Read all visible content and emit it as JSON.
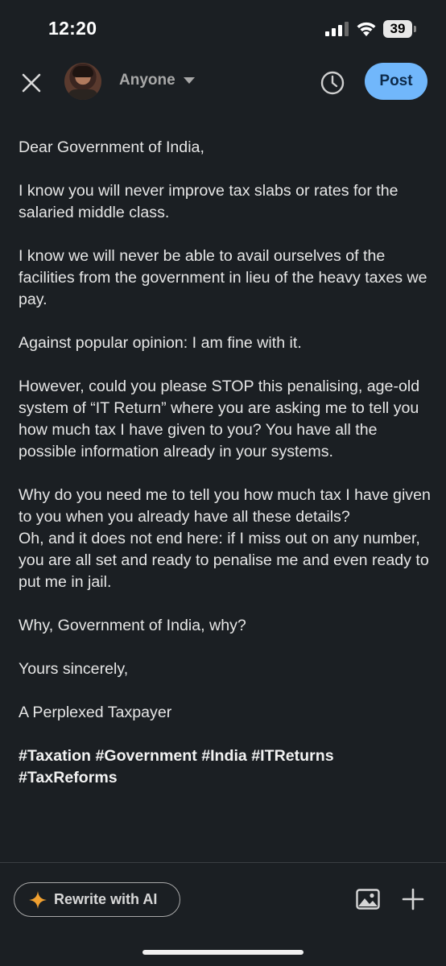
{
  "status_bar": {
    "time": "12:20",
    "battery": "39"
  },
  "header": {
    "close_icon": "close-icon",
    "visibility": "Anyone",
    "schedule_icon": "clock-icon",
    "post_label": "Post"
  },
  "post": {
    "paragraphs": [
      "Dear Government of India,",
      "I know you will never improve tax slabs or rates for the salaried middle class.",
      "I know we will never be able to avail ourselves of the facilities from the government in lieu of the heavy taxes we pay.",
      "Against popular opinion: I am fine with it.",
      "However, could you please STOP this penalising, age-old system of “IT Return” where you are asking me to tell you how much tax I have given to you? You have all the possible information already in your systems.",
      "Why do you need me to tell you how much tax I have given to you when you already have all these details?\nOh, and it does not end here: if I miss out on any number, you are all set and ready to penalise me and even ready to put me in jail.",
      "Why, Government of India, why?",
      "Yours sincerely,",
      "A Perplexed Taxpayer"
    ],
    "hashtags": "#Taxation #Government #India #ITReturns #TaxReforms"
  },
  "toolbar": {
    "rewrite_label": "Rewrite with AI",
    "rewrite_icon": "sparkle-icon",
    "image_icon": "image-icon",
    "add_icon": "plus-icon",
    "accent": "#f0a030"
  },
  "colors": {
    "background": "#1b1f23",
    "post_button": "#71b7fb"
  }
}
